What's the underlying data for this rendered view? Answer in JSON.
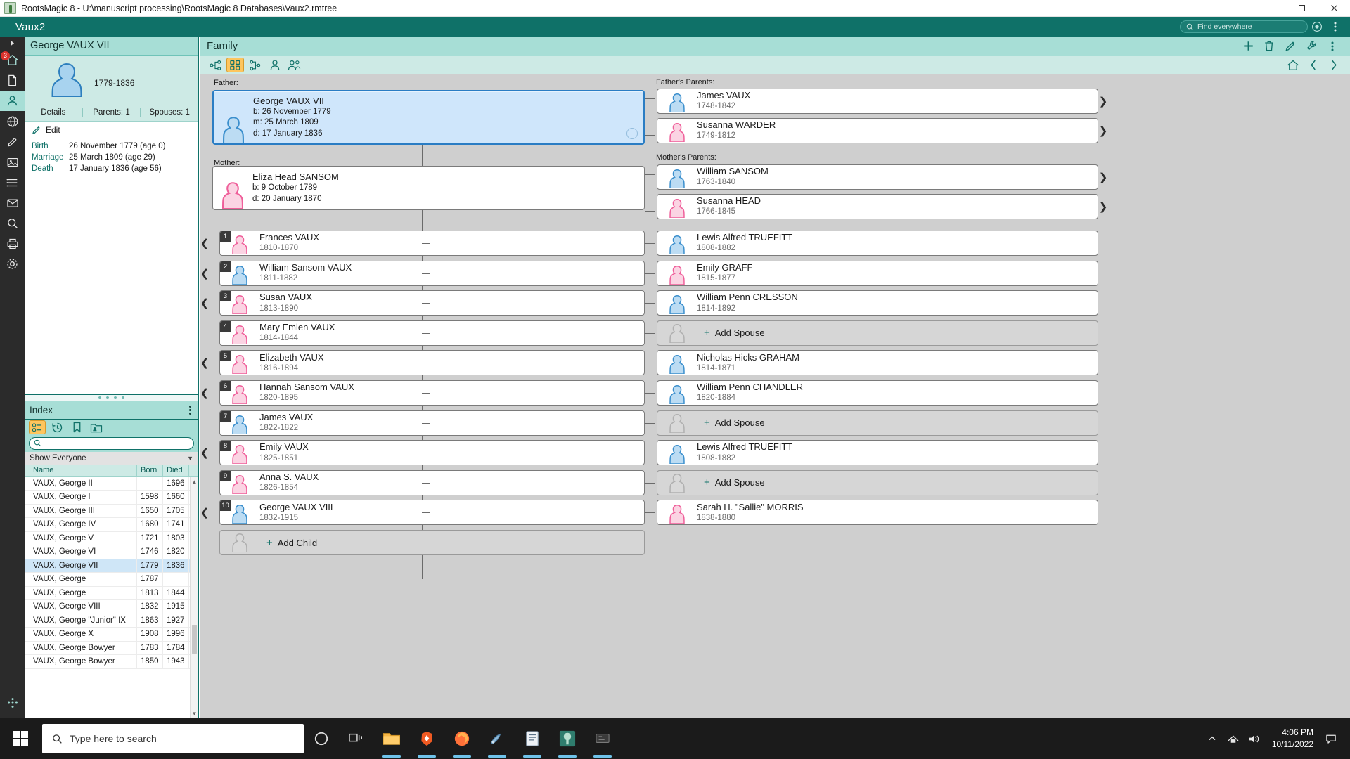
{
  "window": {
    "title": "RootsMagic 8 - U:\\manuscript processing\\RootsMagic 8 Databases\\Vaux2.rmtree",
    "app_icon": "rootsmagic-tree-icon",
    "minimize": "minimize-icon",
    "maximize": "maximize-icon",
    "close": "close-icon"
  },
  "appbar": {
    "database_name": "Vaux2",
    "search_placeholder": "Find everywhere",
    "search_icon": "search-icon",
    "help_icon": "help-circle-icon",
    "overflow_icon": "more-vertical-icon"
  },
  "rail": {
    "collapse_icon": "chevron-right-icon",
    "items": [
      {
        "name": "home",
        "icon": "home-icon",
        "badge": "3",
        "active": false
      },
      {
        "name": "documents",
        "icon": "file-icon",
        "badge": "",
        "active": false
      },
      {
        "name": "people",
        "icon": "person-icon",
        "badge": "",
        "active": true
      },
      {
        "name": "webhints",
        "icon": "globe-icon",
        "badge": "",
        "active": false
      },
      {
        "name": "tools",
        "icon": "pen-icon",
        "badge": "",
        "active": false
      },
      {
        "name": "media",
        "icon": "image-icon",
        "badge": "",
        "active": false
      },
      {
        "name": "lists",
        "icon": "list-icon",
        "badge": "",
        "active": false
      },
      {
        "name": "tasks",
        "icon": "mail-icon",
        "badge": "",
        "active": false
      },
      {
        "name": "search",
        "icon": "magnifier-icon",
        "badge": "",
        "active": false
      },
      {
        "name": "publish",
        "icon": "printer-icon",
        "badge": "",
        "active": false
      },
      {
        "name": "settings",
        "icon": "gear-icon",
        "badge": "",
        "active": false
      }
    ],
    "bottom_icon": "apps-grid-icon"
  },
  "person_panel": {
    "name": "George VAUX VII",
    "years": "1779-1836",
    "avatar": "male-silhouette-icon",
    "tabs": [
      {
        "label": "Details"
      },
      {
        "label": "Parents: 1"
      },
      {
        "label": "Spouses: 1"
      }
    ],
    "edit_label": "Edit",
    "edit_icon": "pencil-icon",
    "facts": [
      {
        "label": "Birth",
        "value": "26 November 1779 (age 0)"
      },
      {
        "label": "Marriage",
        "value": "25 March 1809 (age 29)"
      },
      {
        "label": "Death",
        "value": "17 January 1836 (age 56)"
      }
    ]
  },
  "index_panel": {
    "title": "Index",
    "menu_icon": "more-vertical-icon",
    "tools": [
      {
        "name": "people-list",
        "icon": "people-list-icon",
        "selected": true
      },
      {
        "name": "history",
        "icon": "history-icon",
        "selected": false
      },
      {
        "name": "bookmarks",
        "icon": "bookmark-icon",
        "selected": false
      },
      {
        "name": "groups",
        "icon": "folder-person-icon",
        "selected": false
      }
    ],
    "search_placeholder": "",
    "search_value": "",
    "search_icon": "search-icon",
    "filter_value": "Show Everyone",
    "columns": [
      "Name",
      "Born",
      "Died"
    ],
    "rows": [
      {
        "name": "VAUX, George II",
        "born": "",
        "died": "1696",
        "selected": false
      },
      {
        "name": "VAUX, George I",
        "born": "1598",
        "died": "1660",
        "selected": false
      },
      {
        "name": "VAUX, George III",
        "born": "1650",
        "died": "1705",
        "selected": false
      },
      {
        "name": "VAUX, George IV",
        "born": "1680",
        "died": "1741",
        "selected": false
      },
      {
        "name": "VAUX, George V",
        "born": "1721",
        "died": "1803",
        "selected": false
      },
      {
        "name": "VAUX, George VI",
        "born": "1746",
        "died": "1820",
        "selected": false
      },
      {
        "name": "VAUX, George VII",
        "born": "1779",
        "died": "1836",
        "selected": true
      },
      {
        "name": "VAUX, George",
        "born": "1787",
        "died": "",
        "selected": false
      },
      {
        "name": "VAUX, George",
        "born": "1813",
        "died": "1844",
        "selected": false
      },
      {
        "name": "VAUX, George VIII",
        "born": "1832",
        "died": "1915",
        "selected": false
      },
      {
        "name": "VAUX, George \"Junior\" IX",
        "born": "1863",
        "died": "1927",
        "selected": false
      },
      {
        "name": "VAUX, George X",
        "born": "1908",
        "died": "1996",
        "selected": false
      },
      {
        "name": "VAUX, George Bowyer",
        "born": "1783",
        "died": "1784",
        "selected": false
      },
      {
        "name": "VAUX, George Bowyer",
        "born": "1850",
        "died": "1943",
        "selected": false
      }
    ]
  },
  "main": {
    "title": "Family",
    "header_icons": [
      {
        "name": "add-person-button",
        "icon": "plus-icon"
      },
      {
        "name": "delete-person-button",
        "icon": "trash-icon"
      },
      {
        "name": "edit-person-button",
        "icon": "pencil-icon"
      },
      {
        "name": "tools-button",
        "icon": "wrench-icon"
      },
      {
        "name": "more-button",
        "icon": "more-vertical-icon"
      }
    ],
    "view_tools": [
      {
        "name": "pedigree-view",
        "icon": "pedigree-icon",
        "selected": false
      },
      {
        "name": "family-view",
        "icon": "family-grid-icon",
        "selected": true
      },
      {
        "name": "descendant-view",
        "icon": "descendant-icon",
        "selected": false
      },
      {
        "name": "person-view",
        "icon": "person-icon",
        "selected": false
      },
      {
        "name": "people-view",
        "icon": "people-icon",
        "selected": false
      }
    ],
    "nav_icons": [
      {
        "name": "home-person-button",
        "icon": "home-icon"
      },
      {
        "name": "back-button",
        "icon": "chevron-left-icon"
      },
      {
        "name": "forward-button",
        "icon": "chevron-right-icon"
      }
    ]
  },
  "tree": {
    "labels": {
      "father": "Father:",
      "mother": "Mother:",
      "fathers_parents": "Father's Parents:",
      "mothers_parents": "Mother's Parents:"
    },
    "father": {
      "name": "George VAUX VII",
      "birth": "b: 26 November 1779",
      "marriage": "m: 25 March 1809",
      "death": "d: 17 January 1836",
      "avatar": "male-silhouette-icon",
      "selected": true
    },
    "mother": {
      "name": "Eliza Head SANSOM",
      "birth": "b: 9 October 1789",
      "death": "d: 20 January 1870",
      "avatar": "female-silhouette-icon",
      "selected": false
    },
    "fathers_parents": [
      {
        "name": "James VAUX",
        "years": "1748-1842",
        "avatar": "male-silhouette-icon"
      },
      {
        "name": "Susanna WARDER",
        "years": "1749-1812",
        "avatar": "female-silhouette-icon"
      }
    ],
    "mothers_parents": [
      {
        "name": "William SANSOM",
        "years": "1763-1840",
        "avatar": "male-silhouette-icon"
      },
      {
        "name": "Susanna HEAD",
        "years": "1766-1845",
        "avatar": "female-silhouette-icon"
      }
    ],
    "children": [
      {
        "num": "1",
        "name": "Frances VAUX",
        "years": "1810-1870",
        "sex": "female",
        "has_children": true
      },
      {
        "num": "2",
        "name": "William Sansom VAUX",
        "years": "1811-1882",
        "sex": "male",
        "has_children": true
      },
      {
        "num": "3",
        "name": "Susan VAUX",
        "years": "1813-1890",
        "sex": "female",
        "has_children": true
      },
      {
        "num": "4",
        "name": "Mary Emlen VAUX",
        "years": "1814-1844",
        "sex": "female",
        "has_children": false
      },
      {
        "num": "5",
        "name": "Elizabeth VAUX",
        "years": "1816-1894",
        "sex": "female",
        "has_children": true
      },
      {
        "num": "6",
        "name": "Hannah Sansom VAUX",
        "years": "1820-1895",
        "sex": "female",
        "has_children": true
      },
      {
        "num": "7",
        "name": "James VAUX",
        "years": "1822-1822",
        "sex": "male",
        "has_children": false
      },
      {
        "num": "8",
        "name": "Emily VAUX",
        "years": "1825-1851",
        "sex": "female",
        "has_children": true
      },
      {
        "num": "9",
        "name": "Anna S. VAUX",
        "years": "1826-1854",
        "sex": "female",
        "has_children": false
      },
      {
        "num": "10",
        "name": "George VAUX VIII",
        "years": "1832-1915",
        "sex": "male",
        "has_children": true
      }
    ],
    "add_child_label": "Add Child",
    "add_child_icon": "plus-icon",
    "add_spouse_label": "Add Spouse",
    "spouses": [
      {
        "name": "Lewis Alfred TRUEFITT",
        "years": "1808-1882",
        "sex": "male",
        "add": false
      },
      {
        "name": "Emily GRAFF",
        "years": "1815-1877",
        "sex": "female",
        "add": false
      },
      {
        "name": "William Penn CRESSON",
        "years": "1814-1892",
        "sex": "male",
        "add": false
      },
      {
        "name": "Add Spouse",
        "years": "",
        "sex": "none",
        "add": true
      },
      {
        "name": "Nicholas Hicks GRAHAM",
        "years": "1814-1871",
        "sex": "male",
        "add": false
      },
      {
        "name": "William Penn CHANDLER",
        "years": "1820-1884",
        "sex": "male",
        "add": false
      },
      {
        "name": "Add Spouse",
        "years": "",
        "sex": "none",
        "add": true
      },
      {
        "name": "Lewis Alfred TRUEFITT",
        "years": "1808-1882",
        "sex": "male",
        "add": false
      },
      {
        "name": "Add Spouse",
        "years": "",
        "sex": "none",
        "add": true
      },
      {
        "name": "Sarah H. \"Sallie\" MORRIS",
        "years": "1838-1880",
        "sex": "female",
        "add": false
      }
    ]
  },
  "taskbar": {
    "start_icon": "windows-start-icon",
    "search_placeholder": "Type here to search",
    "search_icon": "search-icon",
    "apps": [
      {
        "name": "cortana",
        "icon": "cortana-circle-icon",
        "running": false
      },
      {
        "name": "task-view",
        "icon": "task-view-icon",
        "running": false
      },
      {
        "name": "file-explorer",
        "icon": "folder-icon",
        "running": false
      },
      {
        "name": "brave-browser",
        "icon": "brave-lion-icon",
        "running": true
      },
      {
        "name": "firefox",
        "icon": "firefox-icon",
        "running": true
      },
      {
        "name": "photo-editor",
        "icon": "photo-editor-icon",
        "running": true
      },
      {
        "name": "text-editor",
        "icon": "text-editor-icon",
        "running": true
      },
      {
        "name": "rootsmagic",
        "icon": "rootsmagic-tree-icon",
        "running": true
      },
      {
        "name": "snip-tool",
        "icon": "snip-icon",
        "running": true
      }
    ],
    "tray": {
      "expand_icon": "chevron-up-icon",
      "network_icon": "network-icon",
      "volume_icon": "volume-icon",
      "time": "4:06 PM",
      "date": "10/11/2022",
      "notifications_icon": "notification-icon"
    },
    "colors": {
      "accent": "#0f7168",
      "selection": "#cfe6fb",
      "highlight": "#fdc55e"
    }
  }
}
